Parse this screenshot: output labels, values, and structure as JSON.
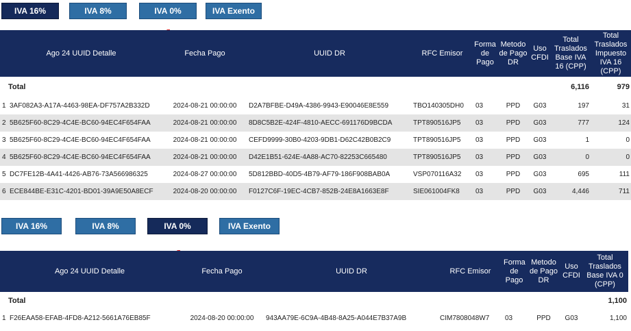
{
  "top_tabs": [
    "IVA 16%",
    "IVA 8%",
    "IVA 0%",
    "IVA Exento"
  ],
  "top_active": 0,
  "table1": {
    "headers": [
      "Ago 24 UUID Detalle",
      "Fecha Pago",
      "UUID DR",
      "RFC Emisor",
      "Forma de Pago",
      "Metodo de Pago DR",
      "Uso CFDI",
      "Total Traslados Base IVA 16 (CPP)",
      "Total Traslados Impuesto IVA 16 (CPP)"
    ],
    "total_label": "Total",
    "totals": [
      "6,116",
      "979"
    ],
    "rows": [
      [
        "1",
        "3AF082A3-A17A-4463-98EA-DF757A2B332D",
        "2024-08-21 00:00:00",
        "D2A7BFBE-D49A-4386-9943-E90046E8E559",
        "TBO140305DH0",
        "03",
        "PPD",
        "G03",
        "197",
        "31"
      ],
      [
        "2",
        "5B625F60-8C29-4C4E-BC60-94EC4F654FAA",
        "2024-08-21 00:00:00",
        "8D8C5B2E-424F-4810-AECC-691176D9BCDA",
        "TPT890516JP5",
        "03",
        "PPD",
        "G03",
        "777",
        "124"
      ],
      [
        "3",
        "5B625F60-8C29-4C4E-BC60-94EC4F654FAA",
        "2024-08-21 00:00:00",
        "CEFD9999-30B0-4203-9DB1-D62C42B0B2C9",
        "TPT890516JP5",
        "03",
        "PPD",
        "G03",
        "1",
        "0"
      ],
      [
        "4",
        "5B625F60-8C29-4C4E-BC60-94EC4F654FAA",
        "2024-08-21 00:00:00",
        "D42E1B51-624E-4A88-AC70-82253C665480",
        "TPT890516JP5",
        "03",
        "PPD",
        "G03",
        "0",
        "0"
      ],
      [
        "5",
        "DC7FE12B-4A41-4426-AB76-73A566986325",
        "2024-08-27 00:00:00",
        "5D812BBD-40D5-4B79-AF79-186F908BAB0A",
        "VSP070116A32",
        "03",
        "PPD",
        "G03",
        "695",
        "111"
      ],
      [
        "6",
        "ECE844BE-E31C-4201-BD01-39A9E50A8ECF",
        "2024-08-20 00:00:00",
        "F0127C6F-19EC-4CB7-852B-24E8A1663E8F",
        "SIE061004FK8",
        "03",
        "PPD",
        "G03",
        "4,446",
        "711"
      ]
    ]
  },
  "bottom_tabs": [
    "IVA 16%",
    "IVA 8%",
    "IVA 0%",
    "IVA Exento"
  ],
  "bottom_active": 2,
  "table2": {
    "headers": [
      "Ago 24 UUID Detalle",
      "Fecha Pago",
      "UUID DR",
      "RFC Emisor",
      "Forma de Pago",
      "Metodo de Pago DR",
      "Uso CFDI",
      "Total Traslados Base IVA 0 (CPP)"
    ],
    "total_label": "Total",
    "totals": [
      "1,100"
    ],
    "rows": [
      [
        "1",
        "F26EAA58-EFAB-4FD8-A212-5661A76EB85F",
        "2024-08-20 00:00:00",
        "943AA79E-6C9A-4B48-8A25-A044E7B37A9B",
        "CIM7808048W7",
        "03",
        "PPD",
        "G03",
        "1,100"
      ]
    ]
  }
}
